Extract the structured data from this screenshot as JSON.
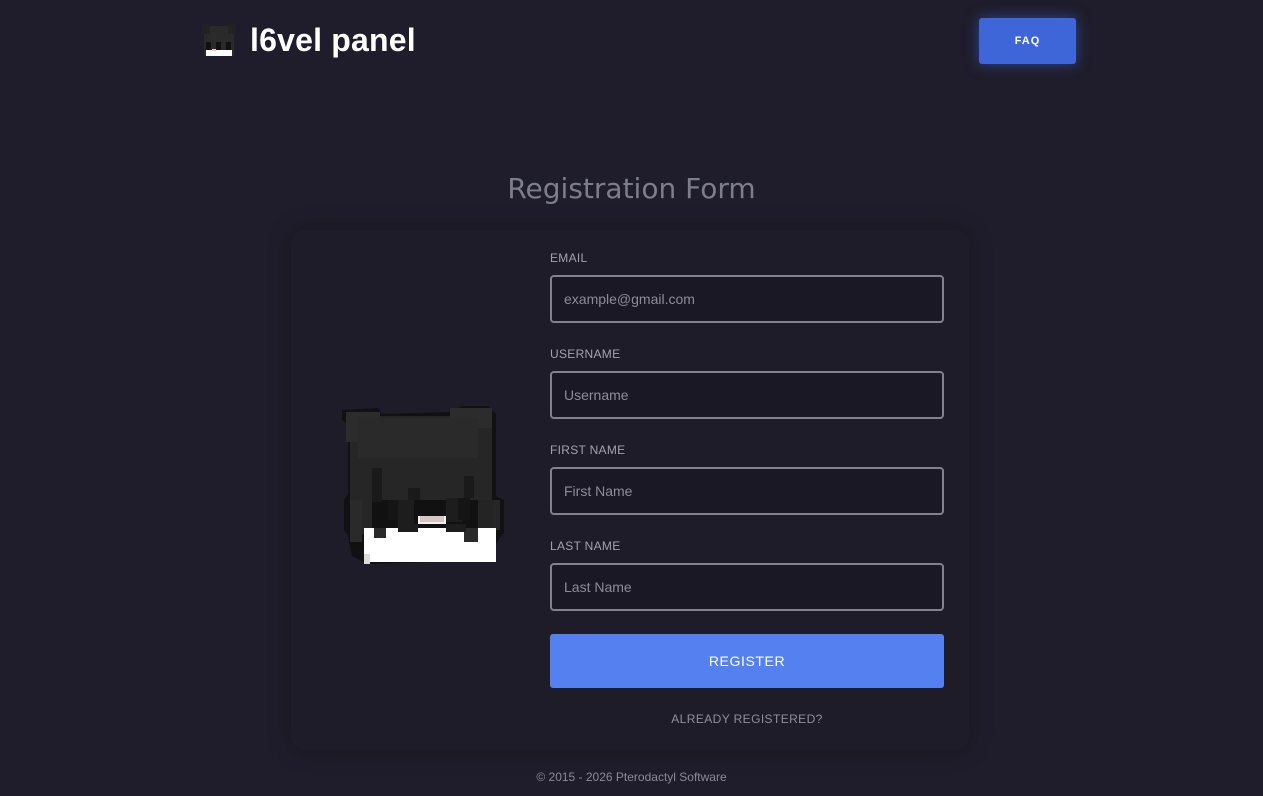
{
  "header": {
    "brand_name": "l6vel panel",
    "logo_icon": "pixel-avatar-icon",
    "faq_label": "FAQ"
  },
  "form": {
    "title": "Registration Form",
    "avatar_icon": "pixel-avatar-icon",
    "fields": [
      {
        "label": "EMAIL",
        "placeholder": "example@gmail.com",
        "value": ""
      },
      {
        "label": "USERNAME",
        "placeholder": "Username",
        "value": ""
      },
      {
        "label": "FIRST NAME",
        "placeholder": "First Name",
        "value": ""
      },
      {
        "label": "LAST NAME",
        "placeholder": "Last Name",
        "value": ""
      }
    ],
    "register_label": "REGISTER",
    "already_registered_label": "ALREADY REGISTERED?"
  },
  "footer": {
    "copyright": "© 2015 - 2026 Pterodactyl Software"
  },
  "colors": {
    "background": "#1f1d2b",
    "accent": "#3f66d8",
    "register_button": "#5481ef",
    "input_border": "#82828e"
  }
}
